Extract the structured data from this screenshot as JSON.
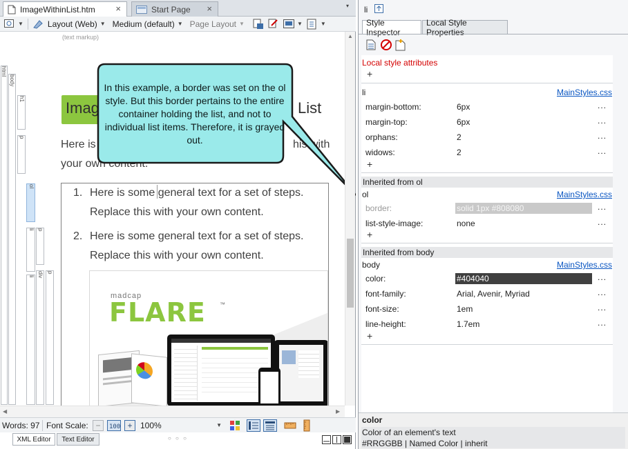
{
  "left_pane": {
    "tabs": [
      {
        "label": "ImageWithinList.htm",
        "active": true,
        "close": "×"
      },
      {
        "label": "Start Page",
        "active": false,
        "close": "×"
      }
    ],
    "toolbar": {
      "layout": "Layout (Web)",
      "medium": "Medium (default)",
      "page_layout": "Page Layout"
    },
    "text_markup_label": "(text markup)",
    "structure_tags": {
      "html": "html",
      "body": "body",
      "h1": "h1",
      "p1": "p",
      "ol": "ol",
      "li1": "li",
      "p2": "p",
      "li2": "li",
      "div": "div",
      "p3": "p"
    },
    "document": {
      "heading_start": "Imag",
      "heading_end": "List",
      "para_start": "Here is",
      "para_end_fragment": "his with",
      "para_line2": "your own content.",
      "list_items": [
        {
          "number": "1.",
          "line1": "Here is some general text for a set of steps.",
          "line2": "Replace this with your own content."
        },
        {
          "number": "2.",
          "line1": "Here is some general text for a set of steps.",
          "line2": "Replace this with your own content."
        }
      ],
      "image": {
        "brand_small": "madcap",
        "brand_big": "FLARE",
        "trademark": "™"
      }
    },
    "callout": "In this example, a border was set on the ol style. But this border pertains to the entire container holding the list, and not to individual list items. Therefore, it is grayed out.",
    "status": {
      "words": "Words: 97",
      "font_scale_label": "Font Scale:",
      "minus": "−",
      "plus": "+",
      "zoom": "100%"
    },
    "bottom_tabs": [
      "XML Editor",
      "Text Editor"
    ],
    "bottom_dots": "○ ○ ○"
  },
  "right_pane": {
    "element_label": "li",
    "tabs": [
      {
        "label": "Style Inspector",
        "active": true
      },
      {
        "label": "Local Style Properties",
        "active": false
      }
    ],
    "local_attributes_label": "Local style attributes",
    "add_symbol": "+",
    "more_symbol": "...",
    "sections": [
      {
        "selector": "li",
        "source": "MainStyles.css",
        "properties": [
          {
            "name": "margin-bottom:",
            "value": "6px"
          },
          {
            "name": "margin-top:",
            "value": "6px"
          },
          {
            "name": "orphans:",
            "value": "2"
          },
          {
            "name": "widows:",
            "value": "2"
          }
        ]
      },
      {
        "header": "Inherited from ol",
        "selector": "ol",
        "source": "MainStyles.css",
        "properties": [
          {
            "name": "border:",
            "value": "solid 1px #808080",
            "grayed": true
          },
          {
            "name": "list-style-image:",
            "value": "none"
          }
        ]
      },
      {
        "header": "Inherited from body",
        "selector": "body",
        "source": "MainStyles.css",
        "properties": [
          {
            "name": "color:",
            "value": "#404040",
            "swatch": "#404040"
          },
          {
            "name": "font-family:",
            "value": "Arial, Avenir, Myriad"
          },
          {
            "name": "font-size:",
            "value": "1em"
          },
          {
            "name": "line-height:",
            "value": "1.7em"
          }
        ]
      }
    ],
    "help": {
      "title": "color",
      "line1": "Color of an element's text",
      "line2": "#RRGGBB | Named Color | inherit"
    }
  },
  "colors": {
    "callout_fill": "#9aeaea",
    "callout_border": "#1a1a1a",
    "heading_bg": "#8cc63f",
    "flare_green": "#8cc63f",
    "link_blue": "#0a56c2",
    "local_attr_red": "#d40000",
    "selected_value_bg": "#404040"
  }
}
